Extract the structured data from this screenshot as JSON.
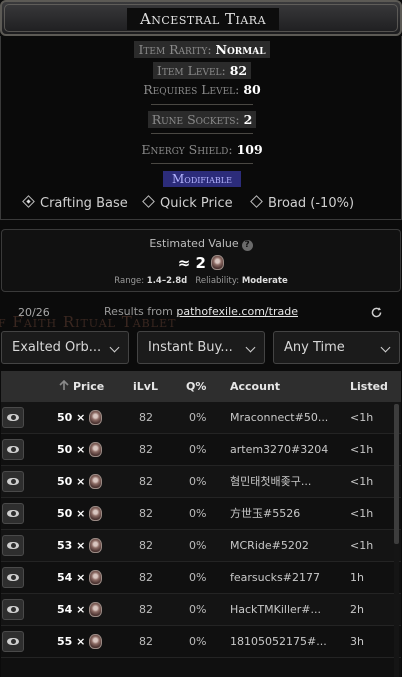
{
  "item": {
    "name": "Ancestral Tiara",
    "rarity_label": "Item Rarity:",
    "rarity_value": "Normal",
    "level_label": "Item Level:",
    "level_value": "82",
    "requires_label": "Requires Level:",
    "requires_value": "80",
    "sockets_label": "Rune Sockets:",
    "sockets_value": "2",
    "es_label": "Energy Shield:",
    "es_value": "109",
    "modifiable": "Modifiable"
  },
  "modes": {
    "crafting_base": "Crafting Base",
    "quick_price": "Quick Price",
    "broad": "Broad (-10%)",
    "selected": "Crafting Base"
  },
  "estimate": {
    "title": "Estimated Value",
    "value": "≈ 2",
    "range_label": "Range:",
    "range_value": "1.4–2.8d",
    "reliability_label": "Reliability:",
    "reliability_value": "Moderate"
  },
  "results": {
    "count": "20/26",
    "source_prefix": "Results from",
    "source_link": "pathofexile.com/trade",
    "watermark": "of Faith Ritual Tablet"
  },
  "filters": {
    "currency": "Exalted Orb...",
    "buyout": "Instant Buy...",
    "time": "Any Time"
  },
  "table": {
    "headers": {
      "price": "Price",
      "ilvl": "iLvL",
      "quality": "Q%",
      "account": "Account",
      "listed": "Listed"
    },
    "rows": [
      {
        "price": "50 ×",
        "ilvl": "82",
        "q": "0%",
        "account": "Mraconnect#50...",
        "listed": "<1h"
      },
      {
        "price": "50 ×",
        "ilvl": "82",
        "q": "0%",
        "account": "artem3270#3204",
        "listed": "<1h"
      },
      {
        "price": "50 ×",
        "ilvl": "82",
        "q": "0%",
        "account": "혐민태첫배좆구...",
        "listed": "<1h"
      },
      {
        "price": "50 ×",
        "ilvl": "82",
        "q": "0%",
        "account": "方世玉#5526",
        "listed": "<1h"
      },
      {
        "price": "53 ×",
        "ilvl": "82",
        "q": "0%",
        "account": "MCRide#5202",
        "listed": "<1h"
      },
      {
        "price": "54 ×",
        "ilvl": "82",
        "q": "0%",
        "account": "fearsucks#2177",
        "listed": "1h"
      },
      {
        "price": "54 ×",
        "ilvl": "82",
        "q": "0%",
        "account": "HackTMKiller#...",
        "listed": "2h"
      },
      {
        "price": "55 ×",
        "ilvl": "82",
        "q": "0%",
        "account": "18105052175#...",
        "listed": "3h"
      }
    ]
  },
  "colors": {
    "background": "#0b0b0b",
    "modifiable_bg": "#2c2c7a",
    "modifiable_text": "#b5b5ff",
    "header_bg": "#2e2e2e"
  },
  "icons": {
    "currency": "exalted-orb-icon",
    "help": "question-circle-icon",
    "refresh": "refresh-icon",
    "view": "eye-icon",
    "sort": "arrow-up-icon"
  }
}
